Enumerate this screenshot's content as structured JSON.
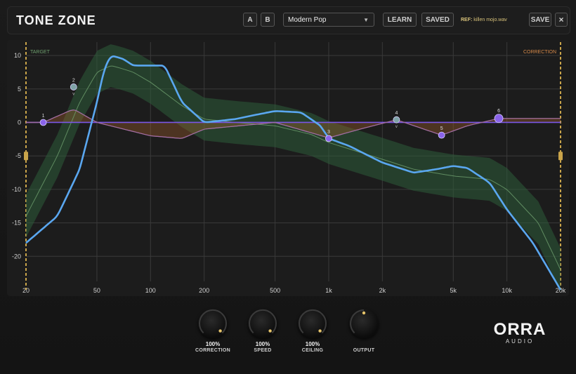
{
  "header": {
    "title": "TONE ZONE",
    "btn_a": "A",
    "btn_b": "B",
    "preset": "Modern Pop",
    "learn": "LEARN",
    "saved": "SAVED",
    "ref_key": "REF:",
    "ref_file": "killen mojo.wav",
    "save": "SAVE",
    "close": "×"
  },
  "graph": {
    "label_target": "TARGET",
    "label_correction": "CORRECTION",
    "colors": {
      "target_line": "#6fa06f",
      "target_band": "#2d5d3a",
      "measured": "#5aa7f0",
      "correction": "#7a56e6",
      "correction_fill": "#a8622e",
      "orange_line": "#d68a4a",
      "gridline": "#3a3a3a",
      "ruler": "#c9a44a"
    },
    "y_ticks": [
      "10",
      "5",
      "0",
      "-5",
      "-10",
      "-15",
      "-20"
    ],
    "x_ticks": [
      "20",
      "50",
      "100",
      "200",
      "500",
      "1k",
      "2k",
      "5k",
      "10k",
      "20k"
    ],
    "nodes": [
      {
        "label": "1",
        "freq": 25,
        "db": 0
      },
      {
        "label": "2",
        "freq": 37,
        "db": 5.3
      },
      {
        "label": "3",
        "freq": 1000,
        "db": -2.4
      },
      {
        "label": "4",
        "freq": 2400,
        "db": 0.4
      },
      {
        "label": "5",
        "freq": 4300,
        "db": -1.9
      },
      {
        "label": "6",
        "freq": 9000,
        "db": 0.6
      }
    ]
  },
  "chart_data": {
    "type": "line",
    "xlabel": "",
    "ylabel": "",
    "x_scale": "log",
    "xlim": [
      20,
      20000
    ],
    "ylim": [
      -25,
      12
    ],
    "grid": true,
    "series": [
      {
        "name": "TARGET",
        "x": [
          20,
          30,
          40,
          50,
          60,
          70,
          80,
          100,
          150,
          200,
          300,
          500,
          800,
          1000,
          2000,
          3000,
          5000,
          8000,
          10000,
          15000,
          20000
        ],
        "y": [
          -14,
          -5,
          3,
          7.5,
          8.5,
          8,
          7.5,
          6,
          2.5,
          0.5,
          0,
          -0.5,
          -1.8,
          -3,
          -5.5,
          -7,
          -8,
          -8.5,
          -10,
          -15,
          -22
        ]
      },
      {
        "name": "CORRECTION",
        "x": [
          20,
          25,
          37,
          50,
          100,
          150,
          200,
          500,
          1000,
          1500,
          2400,
          4300,
          6000,
          9000,
          20000
        ],
        "y": [
          0,
          0,
          2,
          0,
          -2,
          -2.4,
          -1,
          0,
          -2.3,
          -1,
          0.4,
          -1.9,
          -0.5,
          0.6,
          0.6
        ]
      },
      {
        "x": [
          20,
          30,
          40,
          50,
          55,
          60,
          70,
          80,
          100,
          120,
          150,
          200,
          300,
          400,
          500,
          700,
          900,
          1000,
          1300,
          2000,
          3000,
          4000,
          5000,
          6000,
          8000,
          10000,
          14000,
          20000
        ],
        "y": [
          -18,
          -14,
          -7,
          3,
          8,
          10,
          9.5,
          8.5,
          8.5,
          8.5,
          3,
          0,
          0.5,
          1.2,
          1.7,
          1.5,
          -0.5,
          -2.4,
          -3.5,
          -6,
          -7.5,
          -7,
          -6.5,
          -6.8,
          -9,
          -13,
          -18,
          -25
        ]
      }
    ]
  },
  "controls": {
    "knobs": [
      {
        "value": "100%",
        "label": "CORRECTION",
        "level": 1.0
      },
      {
        "value": "100%",
        "label": "SPEED",
        "level": 1.0
      },
      {
        "value": "100%",
        "label": "CEILING",
        "level": 1.0
      },
      {
        "value": "",
        "label": "OUTPUT",
        "level": 0.5
      }
    ]
  },
  "logo": {
    "main": "ORRA",
    "sub": "AUDIO"
  }
}
